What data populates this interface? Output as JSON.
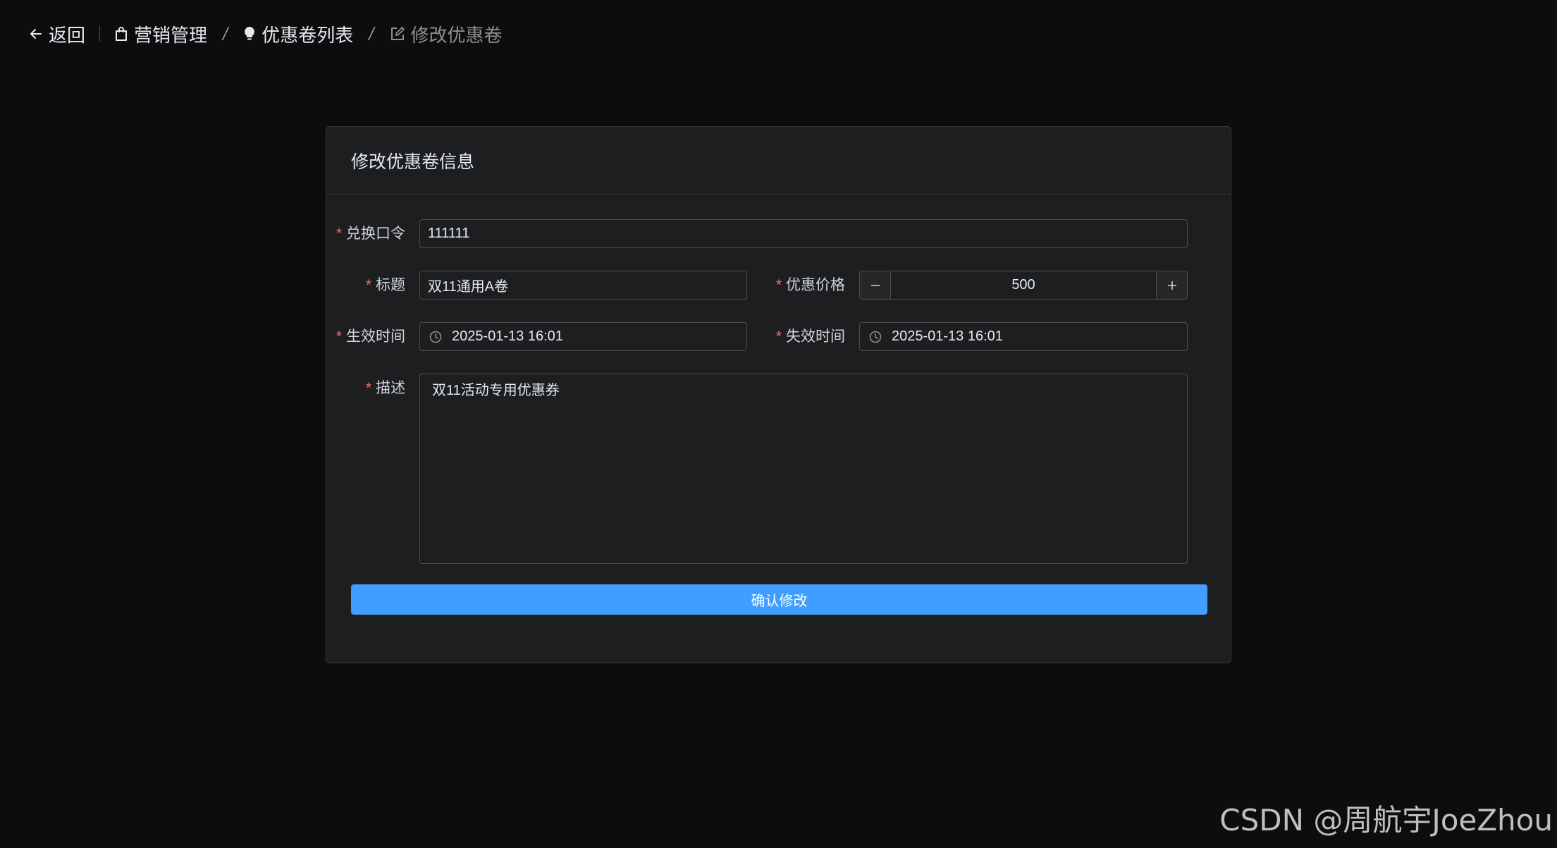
{
  "header": {
    "back_label": "返回",
    "breadcrumb": [
      {
        "label": "营销管理",
        "icon": "shopping-bag-icon"
      },
      {
        "label": "优惠卷列表",
        "icon": "lightbulb-icon"
      },
      {
        "label": "修改优惠卷",
        "icon": "edit-icon"
      }
    ],
    "separator": "/"
  },
  "card": {
    "title": "修改优惠卷信息"
  },
  "form": {
    "required_mark": "*",
    "code": {
      "label": "兑换口令",
      "value": "111111"
    },
    "title": {
      "label": "标题",
      "value": "双11通用A卷"
    },
    "price": {
      "label": "优惠价格",
      "value": "500",
      "minus": "−",
      "plus": "+"
    },
    "start_time": {
      "label": "生效时间",
      "value": "2025-01-13 16:01"
    },
    "end_time": {
      "label": "失效时间",
      "value": "2025-01-13 16:01"
    },
    "description": {
      "label": "描述",
      "value": "双11活动专用优惠券"
    },
    "submit_label": "确认修改"
  },
  "watermark": "CSDN @周航宇JoeZhou",
  "colors": {
    "background": "#0d0d0e",
    "card": "#1d1e1f",
    "border": "#4c4d4f",
    "primary": "#409eff",
    "required": "#f56c6c"
  }
}
